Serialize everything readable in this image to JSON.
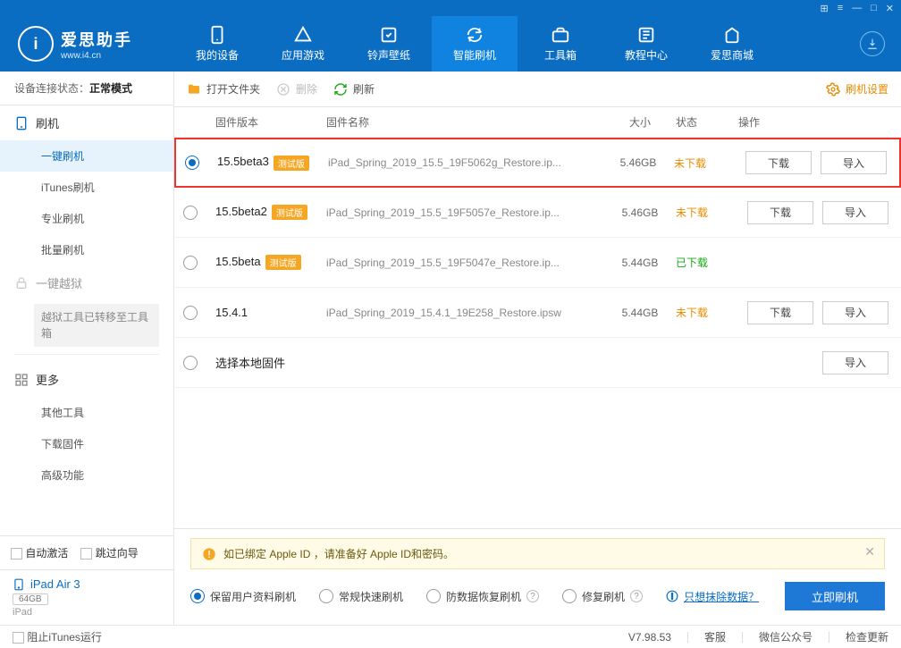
{
  "titlebar": {
    "icons": [
      "⊞",
      "≡",
      "—",
      "□",
      "✕"
    ]
  },
  "logo": {
    "glyph": "i",
    "title": "爱思助手",
    "sub": "www.i4.cn"
  },
  "topTabs": [
    {
      "label": "我的设备"
    },
    {
      "label": "应用游戏"
    },
    {
      "label": "铃声壁纸"
    },
    {
      "label": "智能刷机"
    },
    {
      "label": "工具箱"
    },
    {
      "label": "教程中心"
    },
    {
      "label": "爱思商城"
    }
  ],
  "sidebar": {
    "statusLabel": "设备连接状态：",
    "statusValue": "正常模式",
    "group1": {
      "title": "刷机",
      "items": [
        "一键刷机",
        "iTunes刷机",
        "专业刷机",
        "批量刷机"
      ]
    },
    "group2": {
      "title": "一键越狱",
      "notice": "越狱工具已转移至工具箱"
    },
    "group3": {
      "title": "更多",
      "items": [
        "其他工具",
        "下载固件",
        "高级功能"
      ]
    },
    "autoActivate": "自动激活",
    "skipGuide": "跳过向导"
  },
  "device": {
    "name": "iPad Air 3",
    "cap": "64GB",
    "type": "iPad"
  },
  "toolbar": {
    "openFolder": "打开文件夹",
    "delete": "删除",
    "refresh": "刷新",
    "settings": "刷机设置"
  },
  "columns": {
    "version": "固件版本",
    "name": "固件名称",
    "size": "大小",
    "status": "状态",
    "ops": "操作"
  },
  "rows": [
    {
      "version": "15.5beta3",
      "beta": true,
      "name": "iPad_Spring_2019_15.5_19F5062g_Restore.ip...",
      "size": "5.46GB",
      "status": "not",
      "selected": true,
      "highlight": true,
      "download": true,
      "import": true
    },
    {
      "version": "15.5beta2",
      "beta": true,
      "name": "iPad_Spring_2019_15.5_19F5057e_Restore.ip...",
      "size": "5.46GB",
      "status": "not",
      "selected": false,
      "download": true,
      "import": true
    },
    {
      "version": "15.5beta",
      "beta": true,
      "name": "iPad_Spring_2019_15.5_19F5047e_Restore.ip...",
      "size": "5.44GB",
      "status": "done",
      "selected": false,
      "download": false,
      "import": false
    },
    {
      "version": "15.4.1",
      "beta": false,
      "name": "iPad_Spring_2019_15.4.1_19E258_Restore.ipsw",
      "size": "5.44GB",
      "status": "not",
      "selected": false,
      "download": true,
      "import": true
    },
    {
      "version": "选择本地固件",
      "beta": false,
      "name": "",
      "size": "",
      "status": "",
      "selected": false,
      "download": false,
      "import": true,
      "local": true
    }
  ],
  "statusText": {
    "not": "未下载",
    "done": "已下载"
  },
  "opLabels": {
    "download": "下载",
    "import": "导入"
  },
  "betaTag": "测试版",
  "alert": "如已绑定 Apple ID ，请准备好 Apple ID和密码。",
  "options": {
    "keepData": "保留用户资料刷机",
    "normal": "常规快速刷机",
    "antiData": "防数据恢复刷机",
    "repair": "修复刷机",
    "eraseLink": "只想抹除数据？"
  },
  "flashButton": "立即刷机",
  "footer": {
    "block": "阻止iTunes运行",
    "version": "V7.98.53",
    "links": [
      "客服",
      "微信公众号",
      "检查更新"
    ]
  }
}
